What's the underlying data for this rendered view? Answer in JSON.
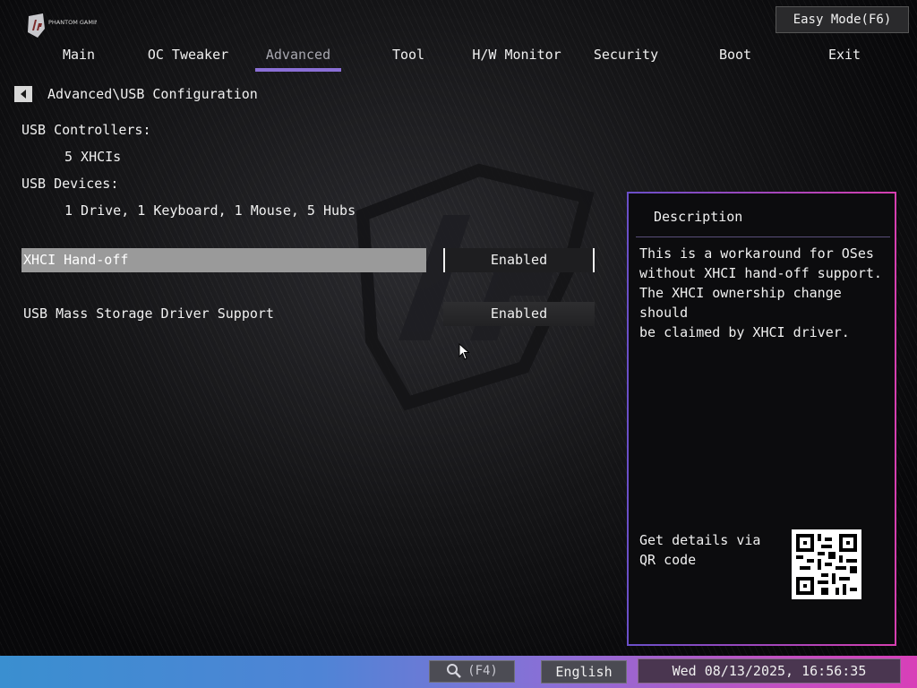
{
  "header": {
    "brand": "PHANTOM GAMING",
    "easy_mode_label": "Easy Mode(F6)"
  },
  "nav": {
    "tabs": [
      {
        "label": "Main"
      },
      {
        "label": "OC Tweaker"
      },
      {
        "label": "Advanced",
        "active": true
      },
      {
        "label": "Tool"
      },
      {
        "label": "H/W Monitor"
      },
      {
        "label": "Security"
      },
      {
        "label": "Boot"
      },
      {
        "label": "Exit"
      }
    ]
  },
  "breadcrumb": "Advanced\\USB Configuration",
  "info": {
    "controllers_label": "USB Controllers:",
    "controllers_value": "5 XHCIs",
    "devices_label": "USB Devices:",
    "devices_value": "1 Drive, 1 Keyboard, 1 Mouse, 5 Hubs"
  },
  "settings": [
    {
      "label": "XHCI Hand-off",
      "value": "Enabled",
      "selected": true
    },
    {
      "label": "USB Mass Storage Driver Support",
      "value": "Enabled",
      "selected": false
    }
  ],
  "description": {
    "title": "Description",
    "text": "This is a workaround for OSes\nwithout XHCI hand-off support.\nThe XHCI ownership change should\nbe claimed by XHCI driver.",
    "qr_text": "Get details via QR code"
  },
  "footer": {
    "search_label": "(F4)",
    "language": "English",
    "datetime": "Wed 08/13/2025, 16:56:35"
  },
  "colors": {
    "accent": "#8a6fd6",
    "panel_border_start": "#6a4fc8",
    "panel_border_end": "#d63fb0",
    "selected_row": "#9a9a9a"
  }
}
